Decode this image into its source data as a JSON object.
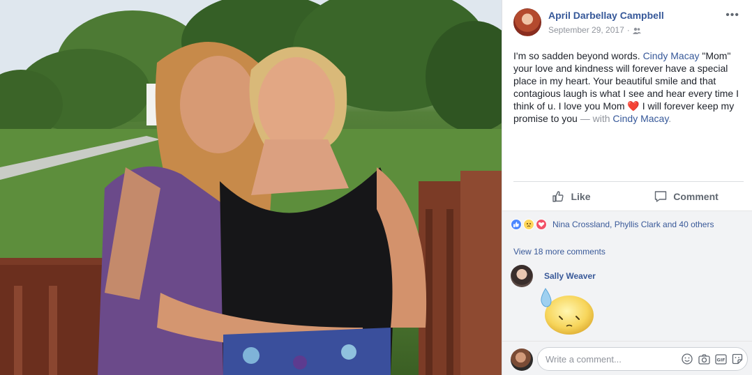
{
  "post": {
    "author": "April Darbellay Campbell",
    "date": "September 29, 2017",
    "separator": "·",
    "audience_icon": "friends-icon",
    "more_label": "•••",
    "text_before": "I'm so sadden beyond words. ",
    "tag_name": "Cindy Macay",
    "text_middle": " \"Mom\" your love and kindness will forever have a special place in my heart. Your beautiful smile and that contagious laugh is what I see and hear every time I think of u. I love you Mom ",
    "heart": "❤️",
    "text_after": " I will forever keep my promise to you ",
    "with_label": "— with ",
    "with_name": "Cindy Macay",
    "end_period": "."
  },
  "actions": {
    "like_label": "Like",
    "comment_label": "Comment"
  },
  "reactions": {
    "icons": [
      "like-icon",
      "sad-icon",
      "love-icon"
    ],
    "summary": "Nina Crossland, Phyllis Clark and 40 others"
  },
  "comments": {
    "view_more": "View 18 more comments",
    "items": [
      {
        "author": "Sally Weaver",
        "sticker": "crying-face-sticker"
      }
    ]
  },
  "composer": {
    "placeholder": "Write a comment...",
    "icons": [
      "emoji-icon",
      "camera-icon",
      "gif-icon",
      "sticker-icon"
    ]
  },
  "colors": {
    "link": "#365899",
    "meta": "#90949c",
    "panel_bg": "#f2f3f5",
    "heart": "#e0245e"
  }
}
